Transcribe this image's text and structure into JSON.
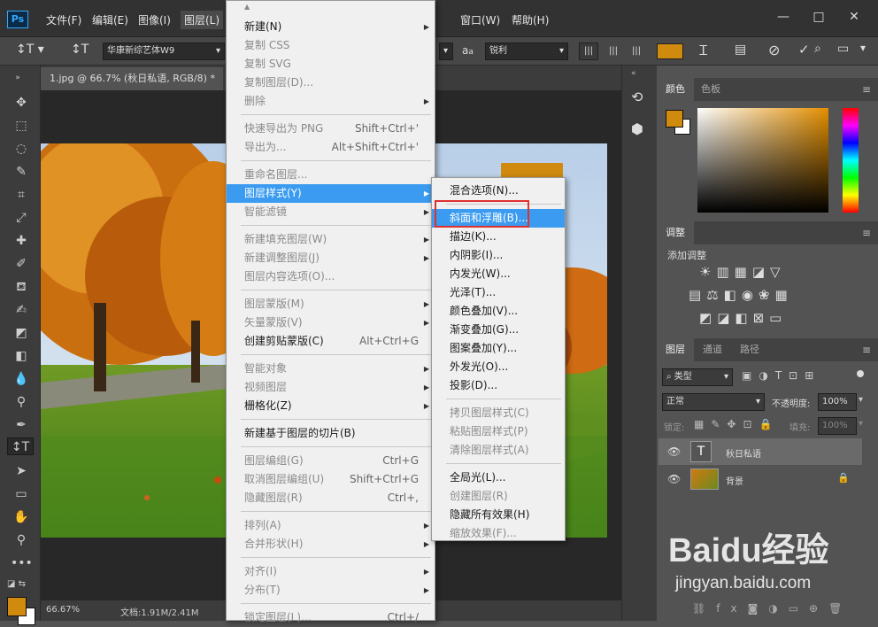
{
  "menubar": {
    "items": [
      "文件(F)",
      "编辑(E)",
      "图像(I)",
      "图层(L)",
      "窗口(W)",
      "帮助(H)"
    ]
  },
  "options": {
    "font_family": "华康新综艺体W9",
    "aa_label": "a",
    "aa_value": "锐利",
    "aa_icon": "aa-icon",
    "color": "#d08b0e"
  },
  "doc": {
    "tab_title": "1.jpg @ 66.7% (秋日私语, RGB/8) *",
    "close": "×",
    "zoom": "66.67%",
    "doc_size": "文档:1.91M/2.41M"
  },
  "layer_menu": {
    "items": [
      {
        "label": "新建(N)",
        "sub": true
      },
      {
        "label": "复制 CSS",
        "dis": true
      },
      {
        "label": "复制 SVG",
        "dis": true
      },
      {
        "label": "复制图层(D)...",
        "dis": true
      },
      {
        "label": "删除",
        "dis": true,
        "sub": true
      },
      {
        "sep": true
      },
      {
        "label": "快速导出为 PNG",
        "dis": true,
        "sc": "Shift+Ctrl+'"
      },
      {
        "label": "导出为...",
        "dis": true,
        "sc": "Alt+Shift+Ctrl+'"
      },
      {
        "sep": true
      },
      {
        "label": "重命名图层...",
        "dis": true
      },
      {
        "label": "图层样式(Y)",
        "hl": true,
        "sub": true
      },
      {
        "label": "智能滤镜",
        "dis": true,
        "sub": true
      },
      {
        "sep": true
      },
      {
        "label": "新建填充图层(W)",
        "dis": true,
        "sub": true
      },
      {
        "label": "新建调整图层(J)",
        "dis": true,
        "sub": true
      },
      {
        "label": "图层内容选项(O)...",
        "dis": true
      },
      {
        "sep": true
      },
      {
        "label": "图层蒙版(M)",
        "dis": true,
        "sub": true
      },
      {
        "label": "矢量蒙版(V)",
        "dis": true,
        "sub": true
      },
      {
        "label": "创建剪贴蒙版(C)",
        "sc": "Alt+Ctrl+G"
      },
      {
        "sep": true
      },
      {
        "label": "智能对象",
        "dis": true,
        "sub": true
      },
      {
        "label": "视频图层",
        "dis": true,
        "sub": true
      },
      {
        "label": "栅格化(Z)",
        "sub": true
      },
      {
        "sep": true
      },
      {
        "label": "新建基于图层的切片(B)"
      },
      {
        "sep": true
      },
      {
        "label": "图层编组(G)",
        "dis": true,
        "sc": "Ctrl+G"
      },
      {
        "label": "取消图层编组(U)",
        "dis": true,
        "sc": "Shift+Ctrl+G"
      },
      {
        "label": "隐藏图层(R)",
        "dis": true,
        "sc": "Ctrl+,"
      },
      {
        "sep": true
      },
      {
        "label": "排列(A)",
        "dis": true,
        "sub": true
      },
      {
        "label": "合并形状(H)",
        "dis": true,
        "sub": true
      },
      {
        "sep": true
      },
      {
        "label": "对齐(I)",
        "dis": true,
        "sub": true
      },
      {
        "label": "分布(T)",
        "dis": true,
        "sub": true
      },
      {
        "sep": true
      },
      {
        "label": "锁定图层(L)...",
        "dis": true,
        "sc": "Ctrl+/"
      }
    ]
  },
  "style_menu": {
    "items": [
      {
        "label": "混合选项(N)..."
      },
      {
        "sep": true
      },
      {
        "label": "斜面和浮雕(B)...",
        "hl": true
      },
      {
        "label": "描边(K)..."
      },
      {
        "label": "内阴影(I)..."
      },
      {
        "label": "内发光(W)..."
      },
      {
        "label": "光泽(T)..."
      },
      {
        "label": "颜色叠加(V)..."
      },
      {
        "label": "渐变叠加(G)..."
      },
      {
        "label": "图案叠加(Y)..."
      },
      {
        "label": "外发光(O)..."
      },
      {
        "label": "投影(D)..."
      },
      {
        "sep": true
      },
      {
        "label": "拷贝图层样式(C)",
        "dis": true
      },
      {
        "label": "粘贴图层样式(P)",
        "dis": true
      },
      {
        "label": "清除图层样式(A)",
        "dis": true
      },
      {
        "sep": true
      },
      {
        "label": "全局光(L)..."
      },
      {
        "label": "创建图层(R)",
        "dis": true
      },
      {
        "label": "隐藏所有效果(H)"
      },
      {
        "label": "缩放效果(F)...",
        "dis": true
      }
    ]
  },
  "color_panel": {
    "tabs": [
      "颜色",
      "色板"
    ],
    "fg": "#d08b0e",
    "bg": "#ffffff"
  },
  "adjust_panel": {
    "tab": "调整",
    "add_label": "添加调整"
  },
  "layers_panel": {
    "tabs": [
      "图层",
      "通道",
      "路径"
    ],
    "filter": "类型",
    "blend": "正常",
    "opacity_label": "不透明度:",
    "opacity": "100%",
    "lock_label": "锁定:",
    "fill_label": "填充:",
    "fill": "100%",
    "layers": [
      {
        "name": "秋日私语",
        "type": "text"
      },
      {
        "name": "背景",
        "type": "image"
      }
    ]
  },
  "watermark": {
    "brand": "Baidu经验",
    "url": "jingyan.baidu.com"
  }
}
